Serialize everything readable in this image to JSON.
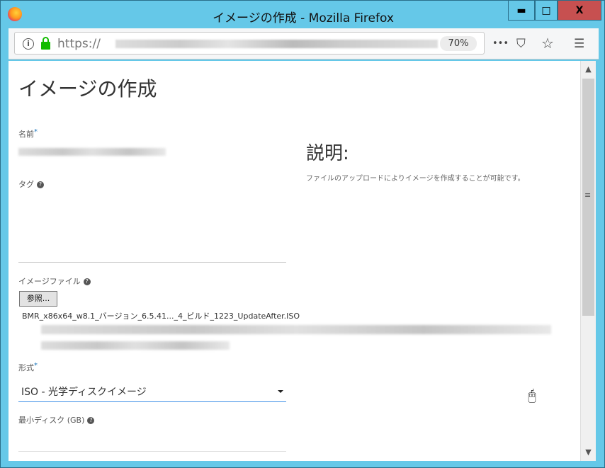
{
  "window": {
    "title": "イメージの作成 - Mozilla Firefox",
    "minimize": "▬",
    "maximize": "□",
    "close": "X"
  },
  "toolbar": {
    "url_prefix": "https://",
    "zoom": "70%",
    "more": "•••",
    "info": "i",
    "menu": "☰",
    "star": "☆",
    "pocket": "⛉"
  },
  "page": {
    "title": "イメージの作成",
    "name_label": "名前",
    "required": "*",
    "tag_label": "タグ",
    "help": "?",
    "image_file_label": "イメージファイル",
    "browse_button": "参照...",
    "file_name": "BMR_x86x64_w8.1_バージョン_6.5.41..._4_ビルド_1223_UpdateAfter.ISO",
    "format_label": "形式",
    "format_value": "ISO - 光学ディスクイメージ",
    "min_disk_label": "最小ディスク (GB)",
    "description_heading": "説明:",
    "description_text": "ファイルのアップロードによりイメージを作成することが可能です。"
  },
  "scrollbar": {
    "up": "▲",
    "down": "▼",
    "grip": "≡"
  }
}
